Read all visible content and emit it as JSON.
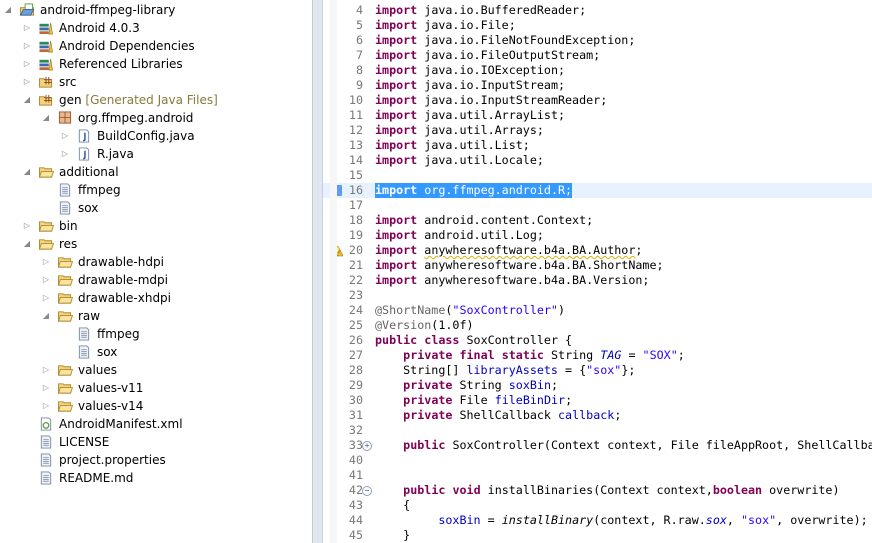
{
  "tree": [
    {
      "label": "android-ffmpeg-library",
      "level": 0,
      "arrow": "open",
      "icon": "project-icon"
    },
    {
      "label": "Android 4.0.3",
      "level": 1,
      "arrow": "closed",
      "icon": "library-icon"
    },
    {
      "label": "Android Dependencies",
      "level": 1,
      "arrow": "closed",
      "icon": "library-icon"
    },
    {
      "label": "Referenced Libraries",
      "level": 1,
      "arrow": "closed",
      "icon": "library-icon"
    },
    {
      "label": "src",
      "level": 1,
      "arrow": "closed",
      "icon": "source-folder-icon"
    },
    {
      "label": "gen",
      "decoration": "[Generated Java Files]",
      "level": 1,
      "arrow": "open",
      "icon": "source-folder-icon"
    },
    {
      "label": "org.ffmpeg.android",
      "level": 2,
      "arrow": "open",
      "icon": "package-icon"
    },
    {
      "label": "BuildConfig.java",
      "level": 3,
      "arrow": "closed",
      "icon": "java-file-icon"
    },
    {
      "label": "R.java",
      "level": 3,
      "arrow": "closed",
      "icon": "java-file-icon"
    },
    {
      "label": "additional",
      "level": 1,
      "arrow": "open",
      "icon": "folder-icon"
    },
    {
      "label": "ffmpeg",
      "level": 2,
      "arrow": "none",
      "icon": "file-icon"
    },
    {
      "label": "sox",
      "level": 2,
      "arrow": "none",
      "icon": "file-icon"
    },
    {
      "label": "bin",
      "level": 1,
      "arrow": "closed",
      "icon": "folder-icon"
    },
    {
      "label": "res",
      "level": 1,
      "arrow": "open",
      "icon": "folder-icon"
    },
    {
      "label": "drawable-hdpi",
      "level": 2,
      "arrow": "closed",
      "icon": "folder-icon"
    },
    {
      "label": "drawable-mdpi",
      "level": 2,
      "arrow": "closed",
      "icon": "folder-icon"
    },
    {
      "label": "drawable-xhdpi",
      "level": 2,
      "arrow": "closed",
      "icon": "folder-icon"
    },
    {
      "label": "raw",
      "level": 2,
      "arrow": "open",
      "icon": "folder-icon"
    },
    {
      "label": "ffmpeg",
      "level": 3,
      "arrow": "none",
      "icon": "file-icon"
    },
    {
      "label": "sox",
      "level": 3,
      "arrow": "none",
      "icon": "file-icon"
    },
    {
      "label": "values",
      "level": 2,
      "arrow": "closed",
      "icon": "folder-icon"
    },
    {
      "label": "values-v11",
      "level": 2,
      "arrow": "closed",
      "icon": "folder-icon"
    },
    {
      "label": "values-v14",
      "level": 2,
      "arrow": "closed",
      "icon": "folder-icon"
    },
    {
      "label": "AndroidManifest.xml",
      "level": 1,
      "arrow": "none",
      "icon": "android-manifest-icon"
    },
    {
      "label": "LICENSE",
      "level": 1,
      "arrow": "none",
      "icon": "file-icon"
    },
    {
      "label": "project.properties",
      "level": 1,
      "arrow": "none",
      "icon": "file-icon"
    },
    {
      "label": "README.md",
      "level": 1,
      "arrow": "none",
      "icon": "file-icon"
    }
  ],
  "editor": {
    "lines": [
      {
        "n": "4",
        "t": [
          [
            "kw",
            "import"
          ],
          [
            "",
            "java.io.BufferedReader;"
          ]
        ]
      },
      {
        "n": "5",
        "t": [
          [
            "kw",
            "import"
          ],
          [
            "",
            "java.io.File;"
          ]
        ]
      },
      {
        "n": "6",
        "t": [
          [
            "kw",
            "import"
          ],
          [
            "",
            "java.io.FileNotFoundException;"
          ]
        ]
      },
      {
        "n": "7",
        "t": [
          [
            "kw",
            "import"
          ],
          [
            "",
            "java.io.FileOutputStream;"
          ]
        ]
      },
      {
        "n": "8",
        "t": [
          [
            "kw",
            "import"
          ],
          [
            "",
            "java.io.IOException;"
          ]
        ]
      },
      {
        "n": "9",
        "t": [
          [
            "kw",
            "import"
          ],
          [
            "",
            "java.io.InputStream;"
          ]
        ]
      },
      {
        "n": "10",
        "t": [
          [
            "kw",
            "import"
          ],
          [
            "",
            "java.io.InputStreamReader;"
          ]
        ]
      },
      {
        "n": "11",
        "t": [
          [
            "kw",
            "import"
          ],
          [
            "",
            "java.util.ArrayList;"
          ]
        ]
      },
      {
        "n": "12",
        "t": [
          [
            "kw",
            "import"
          ],
          [
            "",
            "java.util.Arrays;"
          ]
        ]
      },
      {
        "n": "13",
        "t": [
          [
            "kw",
            "import"
          ],
          [
            "",
            "java.util.List;"
          ]
        ]
      },
      {
        "n": "14",
        "t": [
          [
            "kw",
            "import"
          ],
          [
            "",
            "java.util.Locale;"
          ]
        ]
      },
      {
        "n": "15",
        "t": []
      },
      {
        "n": "16",
        "t": [
          [
            "kw",
            "import"
          ],
          [
            "",
            "org.ffmpeg.android.R;"
          ]
        ],
        "selected": true,
        "marker": "occurrence"
      },
      {
        "n": "17",
        "t": []
      },
      {
        "n": "18",
        "t": [
          [
            "kw",
            "import"
          ],
          [
            "",
            "android.content.Context;"
          ]
        ]
      },
      {
        "n": "19",
        "t": [
          [
            "kw",
            "import"
          ],
          [
            "",
            "android.util.Log;"
          ]
        ]
      },
      {
        "n": "20",
        "t": [
          [
            "kw",
            "import"
          ],
          [
            "warn",
            "anywheresoftware.b4a.BA.Author"
          ],
          [
            "",
            ";"
          ]
        ],
        "marker": "warning"
      },
      {
        "n": "21",
        "t": [
          [
            "kw",
            "import"
          ],
          [
            "",
            "anywheresoftware.b4a.BA.ShortName;"
          ]
        ]
      },
      {
        "n": "22",
        "t": [
          [
            "kw",
            "import"
          ],
          [
            "",
            "anywheresoftware.b4a.BA.Version;"
          ]
        ]
      },
      {
        "n": "23",
        "t": []
      },
      {
        "n": "24",
        "t": [
          [
            "ann",
            "@ShortName"
          ],
          [
            "",
            "("
          ],
          [
            "str",
            "\"SoxController\""
          ],
          [
            "",
            ")"
          ]
        ]
      },
      {
        "n": "25",
        "t": [
          [
            "ann",
            "@Version"
          ],
          [
            "",
            "(1.0f)"
          ]
        ]
      },
      {
        "n": "26",
        "t": [
          [
            "kw",
            "public"
          ],
          [
            "kw",
            "class"
          ],
          [
            "",
            "SoxController {"
          ]
        ]
      },
      {
        "n": "27",
        "t": [
          [
            "",
            "   "
          ],
          [
            "kw",
            "private"
          ],
          [
            "kw",
            "final"
          ],
          [
            "kw",
            "static"
          ],
          [
            "",
            "String"
          ],
          [
            "fld ital",
            "TAG"
          ],
          [
            "",
            "="
          ],
          [
            "str",
            "\"SOX\""
          ],
          [
            "",
            ";"
          ]
        ]
      },
      {
        "n": "28",
        "t": [
          [
            "",
            "    String[] "
          ],
          [
            "fld",
            "libraryAssets"
          ],
          [
            "",
            " = {"
          ],
          [
            "str",
            "\"sox\""
          ],
          [
            "",
            "};"
          ]
        ]
      },
      {
        "n": "29",
        "t": [
          [
            "",
            "   "
          ],
          [
            "kw",
            "private"
          ],
          [
            "",
            "String"
          ],
          [
            "fld",
            "soxBin"
          ],
          [
            "",
            ";"
          ]
        ]
      },
      {
        "n": "30",
        "t": [
          [
            "",
            "   "
          ],
          [
            "kw",
            "private"
          ],
          [
            "",
            "File"
          ],
          [
            "fld",
            "fileBinDir"
          ],
          [
            "",
            ";"
          ]
        ]
      },
      {
        "n": "31",
        "t": [
          [
            "",
            "   "
          ],
          [
            "kw",
            "private"
          ],
          [
            "",
            "ShellCallback"
          ],
          [
            "fld",
            "callback"
          ],
          [
            "",
            ";"
          ]
        ]
      },
      {
        "n": "32",
        "t": []
      },
      {
        "n": "33",
        "t": [
          [
            "",
            "   "
          ],
          [
            "kw",
            "public"
          ],
          [
            "",
            "SoxController(Context context, File fileAppRoot, ShellCallba"
          ]
        ],
        "fold": "expand"
      },
      {
        "n": "40",
        "t": []
      },
      {
        "n": "41",
        "t": []
      },
      {
        "n": "42",
        "t": [
          [
            "",
            "   "
          ],
          [
            "kw",
            "public"
          ],
          [
            "kw",
            "void"
          ],
          [
            "",
            "installBinaries(Context context,"
          ],
          [
            "kw",
            "boolean"
          ],
          [
            "",
            "overwrite)"
          ]
        ],
        "fold": "collapse"
      },
      {
        "n": "43",
        "t": [
          [
            "",
            "    {"
          ]
        ]
      },
      {
        "n": "44",
        "t": [
          [
            "",
            "        "
          ],
          [
            "fld",
            "soxBin"
          ],
          [
            "",
            " = "
          ],
          [
            "ital",
            "installBinary"
          ],
          [
            "",
            "(context, R.raw."
          ],
          [
            "fld ital",
            "sox"
          ],
          [
            "",
            ", "
          ],
          [
            "str",
            "\"sox\""
          ],
          [
            "",
            ", overwrite);"
          ]
        ]
      },
      {
        "n": "45",
        "t": [
          [
            "",
            "    }"
          ]
        ]
      }
    ]
  },
  "colors": {
    "keyword": "#7f0055",
    "string": "#2a00ff",
    "field": "#0000c0",
    "selection": "#3399ff",
    "current_line": "#e8f2fe"
  }
}
